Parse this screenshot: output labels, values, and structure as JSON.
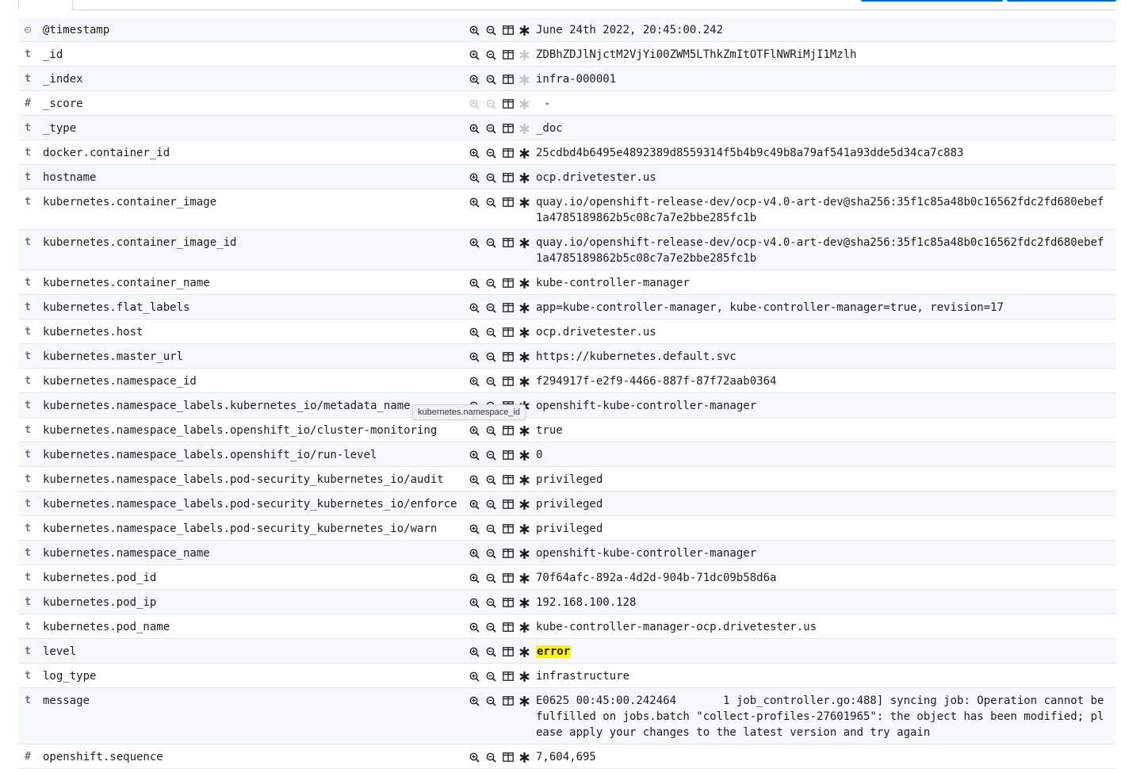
{
  "tooltip": "kubernetes.namespace_id",
  "fields": [
    {
      "type": "◴",
      "name": "@timestamp",
      "value": "June 24th 2022, 20:45:00.242"
    },
    {
      "type": "t",
      "name": "_id",
      "value": "ZDBhZDJlNjctM2VjYi00ZWM5LThkZmItOTFlNWRiMjI1Mzlh"
    },
    {
      "type": "t",
      "name": "_index",
      "value": "infra-000001"
    },
    {
      "type": "#",
      "name": "_score",
      "value": "-"
    },
    {
      "type": "t",
      "name": "_type",
      "value": "_doc"
    },
    {
      "type": "t",
      "name": "docker.container_id",
      "value": "25cdbd4b6495e4892389d8559314f5b4b9c49b8a79af541a93dde5d34ca7c883"
    },
    {
      "type": "t",
      "name": "hostname",
      "value": "ocp.drivetester.us"
    },
    {
      "type": "t",
      "name": "kubernetes.container_image",
      "value": "quay.io/openshift-release-dev/ocp-v4.0-art-dev@sha256:35f1c85a48b0c16562fdc2fd680ebef1a4785189862b5c08c7a7e2bbe285fc1b"
    },
    {
      "type": "t",
      "name": "kubernetes.container_image_id",
      "value": "quay.io/openshift-release-dev/ocp-v4.0-art-dev@sha256:35f1c85a48b0c16562fdc2fd680ebef1a4785189862b5c08c7a7e2bbe285fc1b"
    },
    {
      "type": "t",
      "name": "kubernetes.container_name",
      "value": "kube-controller-manager"
    },
    {
      "type": "t",
      "name": "kubernetes.flat_labels",
      "value": "app=kube-controller-manager, kube-controller-manager=true, revision=17"
    },
    {
      "type": "t",
      "name": "kubernetes.host",
      "value": "ocp.drivetester.us"
    },
    {
      "type": "t",
      "name": "kubernetes.master_url",
      "value": "https://kubernetes.default.svc"
    },
    {
      "type": "t",
      "name": "kubernetes.namespace_id",
      "value": "f294917f-e2f9-4466-887f-87f72aab0364"
    },
    {
      "type": "t",
      "name": "kubernetes.namespace_labels.kubernetes_io/metadata_name",
      "value": "openshift-kube-controller-manager"
    },
    {
      "type": "t",
      "name": "kubernetes.namespace_labels.openshift_io/cluster-monitoring",
      "value": "true"
    },
    {
      "type": "t",
      "name": "kubernetes.namespace_labels.openshift_io/run-level",
      "value": "0"
    },
    {
      "type": "t",
      "name": "kubernetes.namespace_labels.pod-security_kubernetes_io/audit",
      "value": "privileged"
    },
    {
      "type": "t",
      "name": "kubernetes.namespace_labels.pod-security_kubernetes_io/enforce",
      "value": "privileged"
    },
    {
      "type": "t",
      "name": "kubernetes.namespace_labels.pod-security_kubernetes_io/warn",
      "value": "privileged"
    },
    {
      "type": "t",
      "name": "kubernetes.namespace_name",
      "value": "openshift-kube-controller-manager"
    },
    {
      "type": "t",
      "name": "kubernetes.pod_id",
      "value": "70f64afc-892a-4d2d-904b-71dc09b58d6a"
    },
    {
      "type": "t",
      "name": "kubernetes.pod_ip",
      "value": "192.168.100.128"
    },
    {
      "type": "t",
      "name": "kubernetes.pod_name",
      "value": "kube-controller-manager-ocp.drivetester.us"
    },
    {
      "type": "t",
      "name": "level",
      "value": "error"
    },
    {
      "type": "t",
      "name": "log_type",
      "value": "infrastructure"
    },
    {
      "type": "t",
      "name": "message",
      "value": "E0625 00:45:00.242464       1 job_controller.go:488] syncing job: Operation cannot be fulfilled on jobs.batch \"collect-profiles-27601965\": the object has been modified; please apply your changes to the latest version and try again"
    },
    {
      "type": "#",
      "name": "openshift.sequence",
      "value": "7,604,695"
    }
  ]
}
